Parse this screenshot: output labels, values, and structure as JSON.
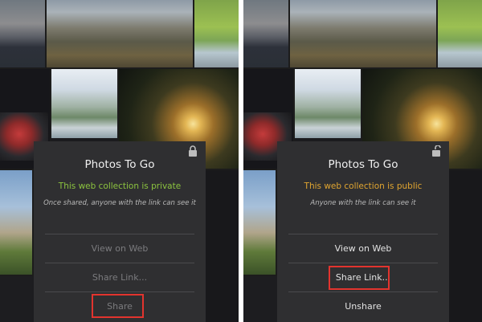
{
  "panels": {
    "left": {
      "title": "Photos To Go",
      "status": "This web collection is private",
      "note": "Once shared, anyone with the link can see it",
      "buttons": {
        "view_on_web": "View on Web",
        "share_link": "Share Link...",
        "share": "Share"
      },
      "lock_state": "locked",
      "highlighted_button": "share"
    },
    "right": {
      "title": "Photos To Go",
      "status": "This web collection is public",
      "note": "Anyone with the link can see it",
      "buttons": {
        "view_on_web": "View on Web",
        "share_link": "Share Link...",
        "unshare": "Unshare"
      },
      "lock_state": "unlocked",
      "highlighted_button": "share_link"
    }
  },
  "colors": {
    "private_status": "#8cc43f",
    "public_status": "#e0a531",
    "highlight": "#e2342e",
    "modal_bg": "#2f2f31"
  },
  "icons": {
    "left_lock": "lock-icon",
    "right_lock": "unlock-icon"
  }
}
